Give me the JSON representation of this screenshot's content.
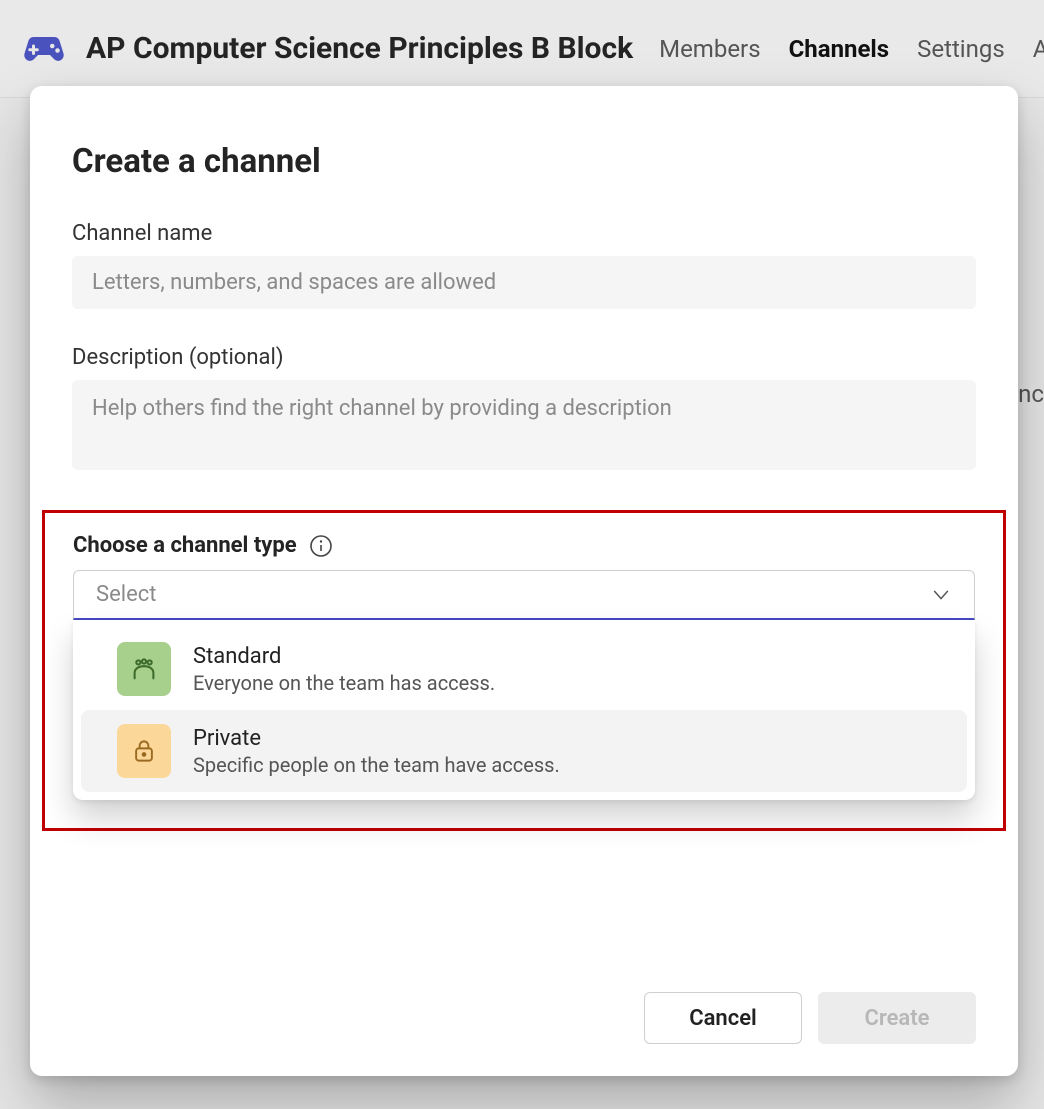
{
  "header": {
    "team_name": "AP Computer Science Principles B Block",
    "tabs": {
      "members": "Members",
      "channels": "Channels",
      "settings": "Settings",
      "more": "An"
    },
    "bg_snippet": "enc"
  },
  "modal": {
    "title": "Create a channel",
    "name_label": "Channel name",
    "name_placeholder": "Letters, numbers, and spaces are allowed",
    "desc_label": "Description (optional)",
    "desc_placeholder": "Help others find the right channel by providing a description",
    "type_label": "Choose a channel type",
    "select_placeholder": "Select",
    "options": {
      "standard": {
        "title": "Standard",
        "desc": "Everyone on the team has access."
      },
      "private": {
        "title": "Private",
        "desc": "Specific people on the team have access."
      }
    },
    "buttons": {
      "cancel": "Cancel",
      "create": "Create"
    }
  }
}
